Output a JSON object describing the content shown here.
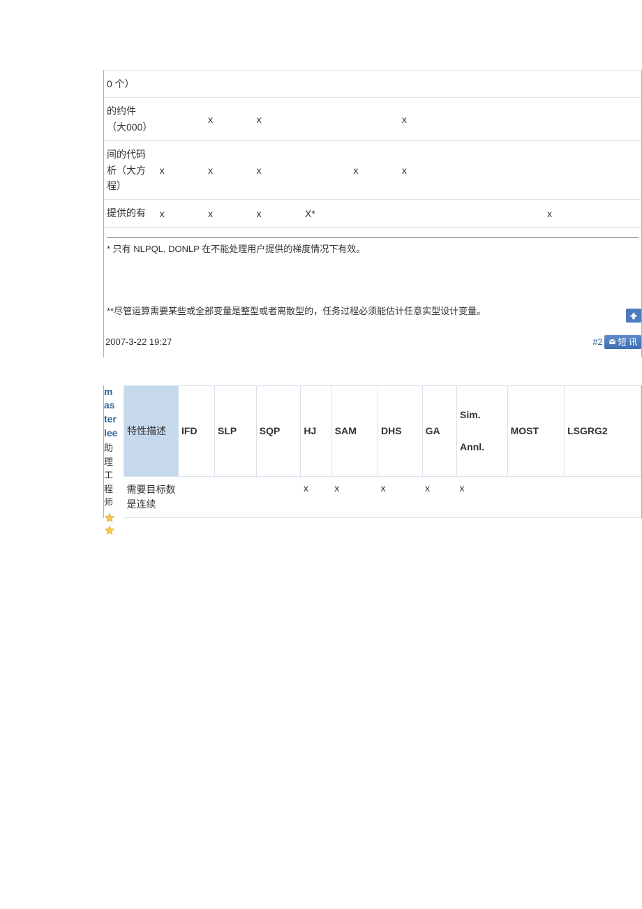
{
  "post1": {
    "rows": [
      {
        "label": "0 个）",
        "marks": [
          "",
          "",
          "",
          "",
          "",
          "",
          "",
          "",
          "",
          ""
        ]
      },
      {
        "label": "的约件（大000）",
        "marks": [
          "",
          "x",
          "x",
          "",
          "",
          "x",
          "",
          "",
          "",
          ""
        ]
      },
      {
        "label": "间的代码析（大方程）",
        "marks": [
          "x",
          "x",
          "x",
          "",
          "x",
          "x",
          "",
          "",
          "",
          ""
        ]
      },
      {
        "label": "提供的有",
        "marks": [
          "x",
          "x",
          "x",
          "X*",
          "",
          "",
          "",
          "",
          "x",
          ""
        ]
      }
    ],
    "footnote1": "* 只有 NLPQL. DONLP 在不能处理用户提供的梯度情况下有效。",
    "footnote2": "**尽管运算需要某些或全部变量是整型或者离散型的，任务过程必须能估计任意实型设计变量。",
    "timestamp": "2007-3-22 19:27",
    "postnum": "#2",
    "msg_label": "短 讯"
  },
  "post2": {
    "username": "masterlee",
    "usertitle": "助理工程师",
    "desc_col_label": "特性描述",
    "headers": [
      "IFD",
      "SLP",
      "SQP",
      "HJ",
      "SAM",
      "DHS",
      "GA",
      "Sim.\nAnnl.",
      "MOST",
      "LSGRG2"
    ],
    "row1": {
      "label": "需要目标数是连续",
      "marks": [
        "",
        "",
        "",
        "x",
        "x",
        "x",
        "x",
        "x",
        "",
        ""
      ]
    }
  }
}
